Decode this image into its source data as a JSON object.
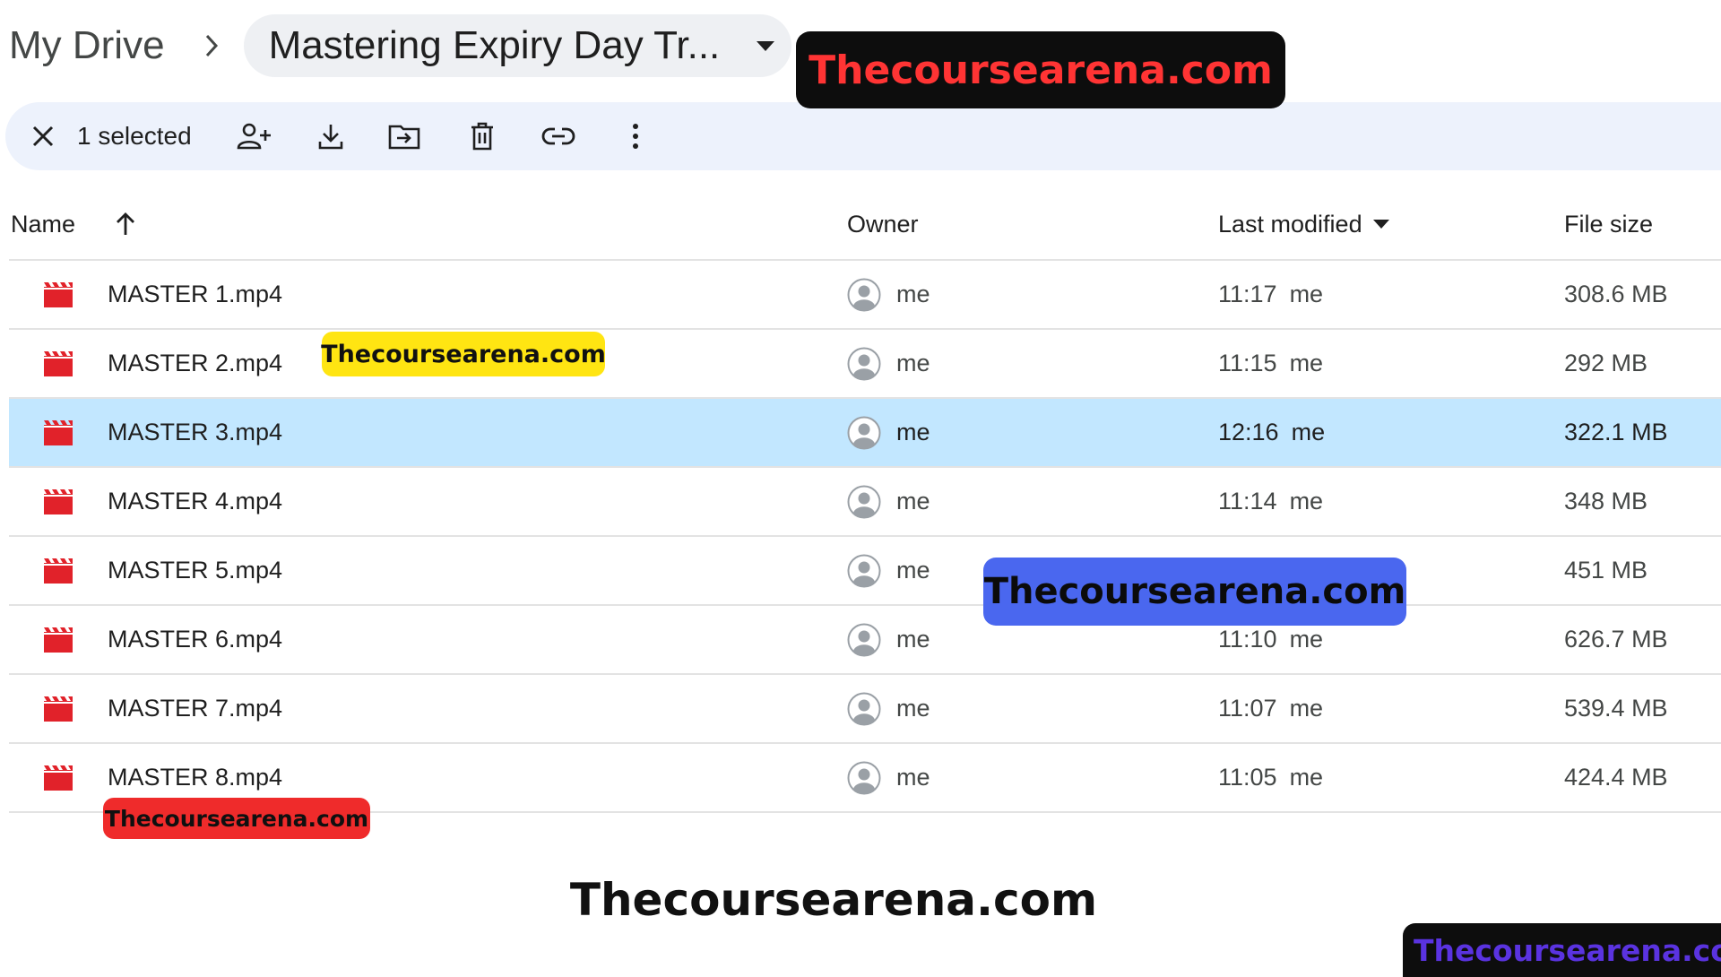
{
  "breadcrumb": {
    "root": "My Drive",
    "current": "Mastering Expiry Day Tr..."
  },
  "toolbar": {
    "selected_count": "1 selected"
  },
  "columns": {
    "name": "Name",
    "owner": "Owner",
    "last_modified": "Last modified",
    "file_size": "File size"
  },
  "files": [
    {
      "name": "MASTER 1.mp4",
      "owner": "me",
      "modified": "11:17",
      "modified_by": "me",
      "size": "308.6 MB"
    },
    {
      "name": "MASTER 2.mp4",
      "owner": "me",
      "modified": "11:15",
      "modified_by": "me",
      "size": "292 MB"
    },
    {
      "name": "MASTER 3.mp4",
      "owner": "me",
      "modified": "12:16",
      "modified_by": "me",
      "size": "322.1 MB"
    },
    {
      "name": "MASTER 4.mp4",
      "owner": "me",
      "modified": "11:14",
      "modified_by": "me",
      "size": "348 MB"
    },
    {
      "name": "MASTER 5.mp4",
      "owner": "me",
      "modified": "",
      "modified_by": "",
      "size": "451 MB"
    },
    {
      "name": "MASTER 6.mp4",
      "owner": "me",
      "modified": "11:10",
      "modified_by": "me",
      "size": "626.7 MB"
    },
    {
      "name": "MASTER 7.mp4",
      "owner": "me",
      "modified": "11:07",
      "modified_by": "me",
      "size": "539.4 MB"
    },
    {
      "name": "MASTER 8.mp4",
      "owner": "me",
      "modified": "11:05",
      "modified_by": "me",
      "size": "424.4 MB"
    }
  ],
  "watermarks": {
    "top": "Thecoursearena.com",
    "yellow": "Thecoursearena.com",
    "blue": "Thecoursearena.com",
    "red": "Thecoursearena.com",
    "plain": "Thecoursearena.com",
    "corner": "Thecoursearena.com"
  },
  "colors": {
    "selected_row": "#c2e7ff",
    "toolbar_bg": "#edf2fc",
    "video_icon": "#e1222a"
  }
}
